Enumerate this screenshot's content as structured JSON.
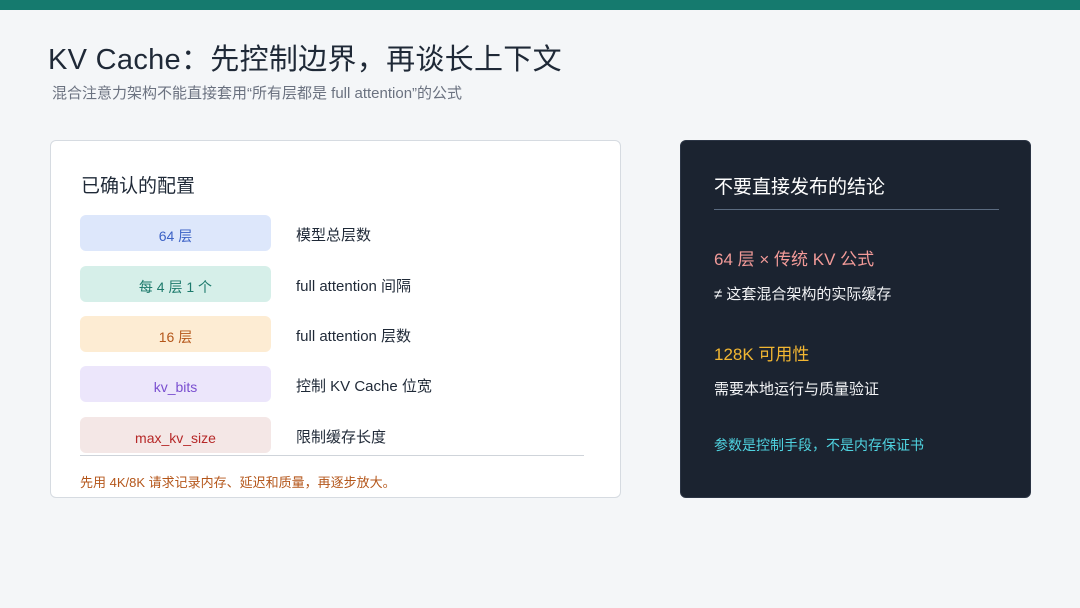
{
  "header": {
    "title": "KV Cache：先控制边界，再谈长上下文",
    "subtitle": "混合注意力架构不能直接套用“所有层都是 full attention”的公式"
  },
  "left_card": {
    "title": "已确认的配置",
    "rows": [
      {
        "tag": "64 层",
        "desc": "模型总层数",
        "bg": "#dde7fb",
        "fg": "#3c62c6"
      },
      {
        "tag": "每 4 层 1 个",
        "desc": "full attention 间隔",
        "bg": "#d6efe9",
        "fg": "#1d7a6c"
      },
      {
        "tag": "16 层",
        "desc": "full attention 层数",
        "bg": "#fdecd3",
        "fg": "#b4561a"
      },
      {
        "tag": "kv_bits",
        "desc": "控制 KV Cache 位宽",
        "bg": "#ece6fb",
        "fg": "#7a4fd0"
      },
      {
        "tag": "max_kv_size",
        "desc": "限制缓存长度",
        "bg": "#f4e7e6",
        "fg": "#b62828"
      }
    ],
    "footnote": "先用 4K/8K 请求记录内存、延迟和质量，再逐步放大。"
  },
  "right_card": {
    "title": "不要直接发布的结论",
    "point1_title": "64 层 × 传统 KV 公式",
    "point1_desc": "≠ 这套混合架构的实际缓存",
    "point2_title": "128K 可用性",
    "point2_desc": "需要本地运行与质量验证",
    "note": "参数是控制手段，不是内存保证书"
  },
  "colors": {
    "accent": "#157a6e",
    "dark_panel": "#1b2330",
    "pink": "#f29a98",
    "yellow": "#f2b632",
    "cyan": "#4fd3e0",
    "orange": "#b4561a"
  }
}
